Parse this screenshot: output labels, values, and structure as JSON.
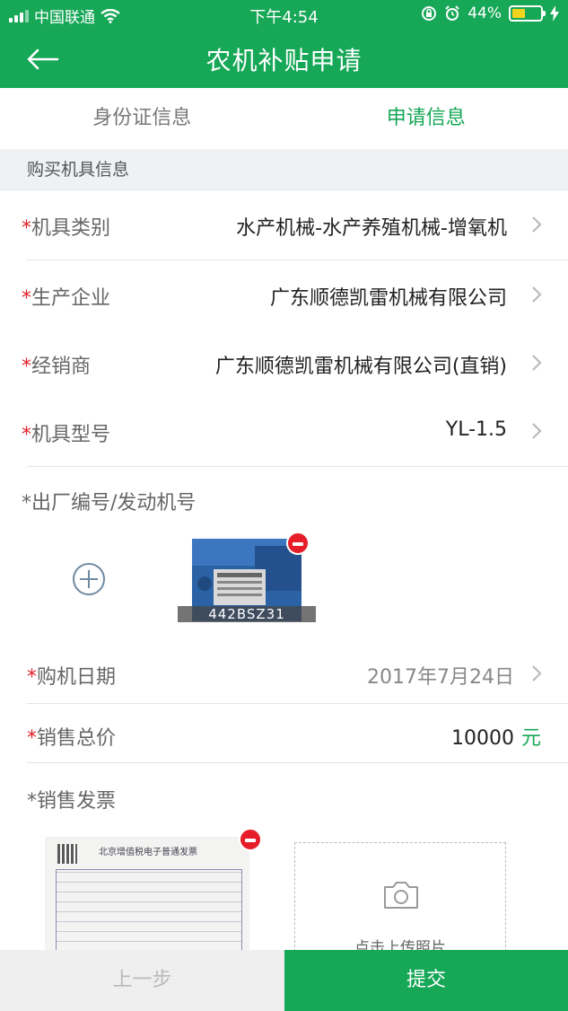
{
  "status": {
    "carrier": "中国联通",
    "time": "下午4:54",
    "battery": "44%"
  },
  "header": {
    "title": "农机补贴申请"
  },
  "tabs": [
    {
      "label": "身份证信息",
      "active": false
    },
    {
      "label": "申请信息",
      "active": true
    }
  ],
  "section": {
    "title": "购买机具信息"
  },
  "fields": {
    "category": {
      "required": "*",
      "label": "机具类别",
      "value": "水产机械-水产养殖机械-增氧机"
    },
    "manufacturer": {
      "required": "*",
      "label": "生产企业",
      "value": "广东顺德凯雷机械有限公司"
    },
    "dealer": {
      "required": "*",
      "label": "经销商",
      "value": "广东顺德凯雷机械有限公司(直销)"
    },
    "model": {
      "required": "*",
      "label": "机具型号",
      "value": "YL-1.5"
    },
    "serial": {
      "required": "*",
      "label": "出厂编号/发动机号",
      "photo_caption": "442BSZ31"
    },
    "purchase_date": {
      "required": "*",
      "label": "购机日期",
      "value": "2017年7月24日"
    },
    "total_price": {
      "required": "*",
      "label": "销售总价",
      "value": "10000",
      "unit": "元"
    },
    "invoice": {
      "required": "*",
      "label": "销售发票",
      "invoice_header": "北京增值税电子普通发票",
      "upload_hint": "点击上传照片"
    }
  },
  "footer": {
    "prev": "上一步",
    "submit": "提交"
  },
  "colors": {
    "brand": "#16a757",
    "required": "#e0202a",
    "remove": "#e61e2a"
  }
}
